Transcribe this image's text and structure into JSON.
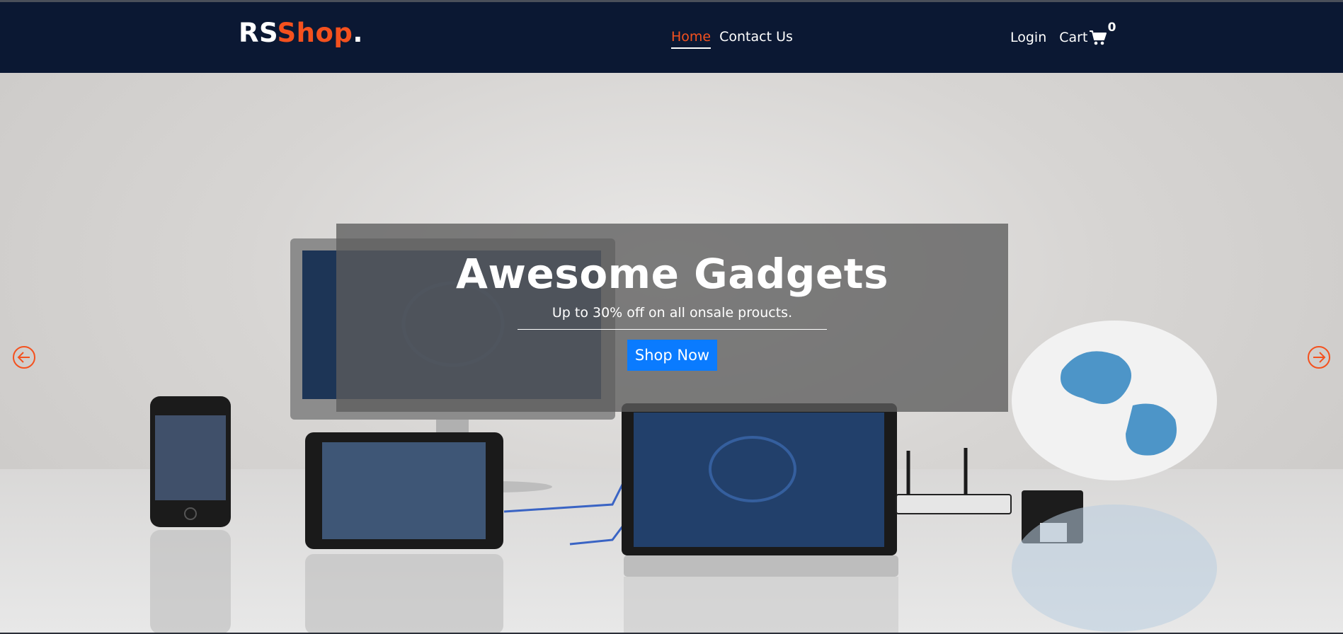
{
  "brand": {
    "part1": "RS",
    "part2": "Shop",
    "part3": "."
  },
  "nav": {
    "links": [
      {
        "label": "Home",
        "active": true
      },
      {
        "label": "Contact Us",
        "active": false
      }
    ],
    "login_label": "Login",
    "cart_label": "Cart",
    "cart_count": "0"
  },
  "hero": {
    "title": "Awesome Gadgets",
    "subtitle": "Up to 30% off on all onsale proucts.",
    "button_label": "Shop Now"
  },
  "icons": {
    "cart": "shopping-cart-icon",
    "prev": "arrow-left-circle-icon",
    "next": "arrow-right-circle-icon"
  },
  "colors": {
    "navbar_bg": "#0b1833",
    "accent": "#f4511e",
    "button": "#0a7bff"
  }
}
